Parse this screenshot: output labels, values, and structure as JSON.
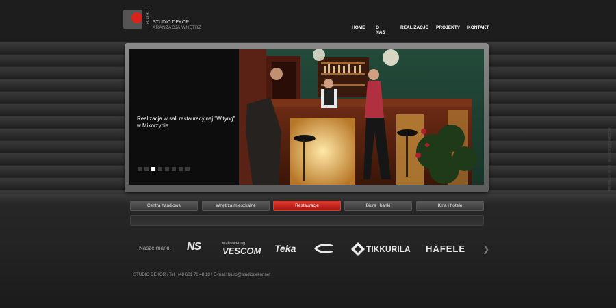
{
  "header": {
    "logo_vertical": "DEKOR",
    "brand_name": "STUDIO DEKOR",
    "brand_sub": "ARANŻACJA WNĘTRZ"
  },
  "nav": [
    "HOME",
    "O NAS",
    "REALIZACJE",
    "PROJEKTY",
    "KONTAKT"
  ],
  "slider": {
    "caption": "Realizacja w sali restauracyjnej \"Wityng\" w Mikorzynie",
    "dot_count": 8,
    "active_dot": 2
  },
  "tabs": [
    {
      "label": "Centra handlowe",
      "active": false
    },
    {
      "label": "Wnętrza mieszkalne",
      "active": false
    },
    {
      "label": "Restauracje",
      "active": true
    },
    {
      "label": "Biura i banki",
      "active": false
    },
    {
      "label": "Kina i hotele",
      "active": false
    }
  ],
  "brands": {
    "label": "Nasze marki:",
    "items": {
      "ns": "NS",
      "vescom_top": "wallcovering",
      "vescom": "VESCOM",
      "teka": "Teka",
      "tikkurila": "TIKKURILA",
      "hafele": "HÄFELE"
    }
  },
  "footer": "STUDIO DEKOR / Tel. +48 601 76 48 18 / E-mail: biuro@studiodekor.net",
  "side_text": "+48 601 76 48 18 · biuro@studiodekor.net",
  "colors": {
    "accent": "#d9231b",
    "background": "#1b1b1b"
  }
}
